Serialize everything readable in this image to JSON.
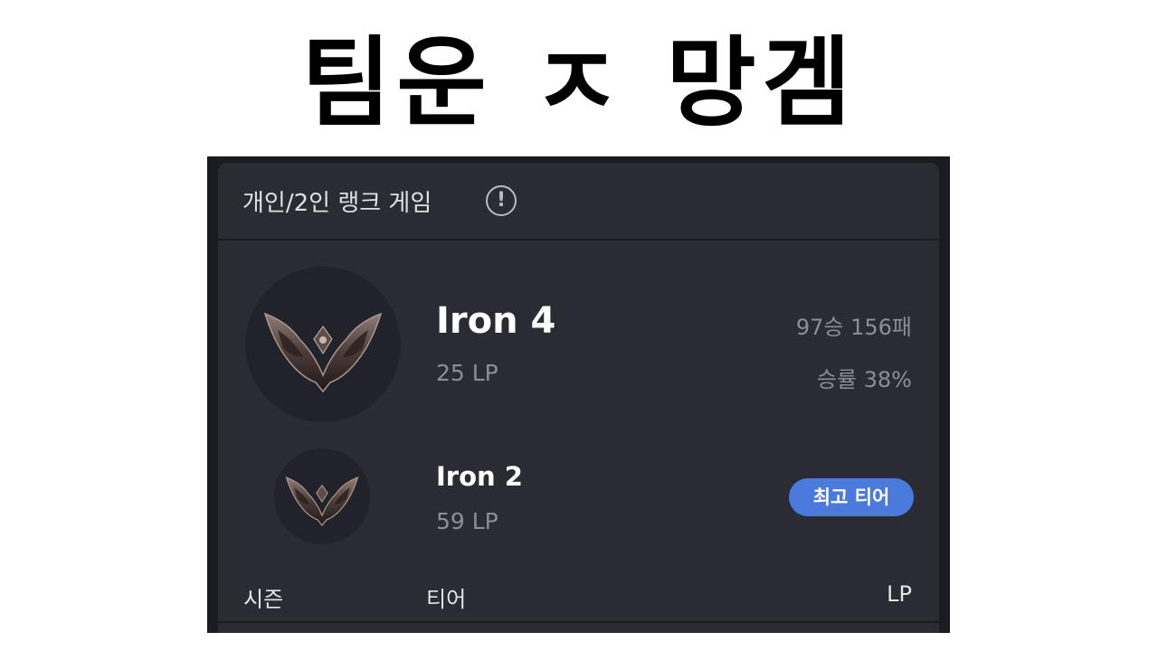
{
  "title": "팀운 ㅈ 망겜",
  "panel": {
    "heading": "개인/2인 랭크 게임",
    "info_symbol": "!"
  },
  "current_rank": {
    "tier": "Iron 4",
    "lp": "25 LP",
    "record": "97승 156패",
    "win_rate": "승률 38%"
  },
  "best_rank": {
    "tier": "Iron 2",
    "lp": "59 LP",
    "badge": "최고 티어"
  },
  "table": {
    "columns": [
      "시즌",
      "티어",
      "LP"
    ]
  },
  "colors": {
    "panel_bg": "#2b2c33",
    "badge_bg": "#4a7bdc",
    "muted_text": "#8b8d98"
  },
  "icons": {
    "info": "info-circle-icon",
    "emblem": "iron-emblem-icon"
  }
}
